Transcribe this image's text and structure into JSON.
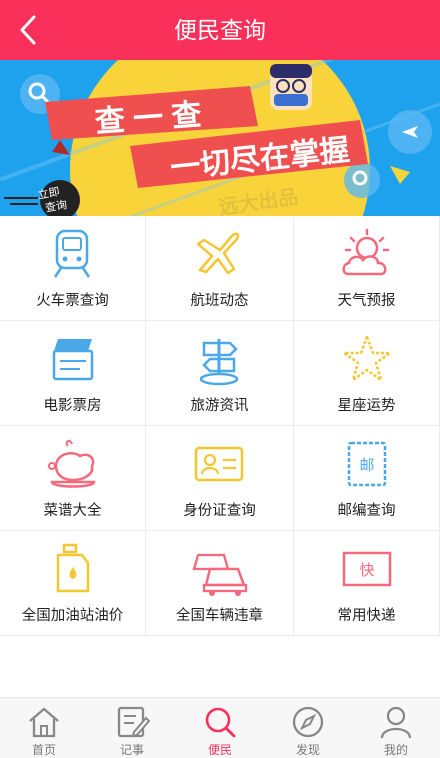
{
  "header": {
    "title": "便民查询"
  },
  "banner": {
    "headline_1": "查 一 查",
    "headline_2": "一切尽在掌握",
    "badge": [
      "立即",
      "查询"
    ],
    "watermark": "远大出品"
  },
  "services": [
    {
      "label": "火车票查询",
      "icon": "train-icon",
      "color": "#4aa8e8"
    },
    {
      "label": "航班动态",
      "icon": "airplane-icon",
      "color": "#f6c631"
    },
    {
      "label": "天气预报",
      "icon": "weather-icon",
      "color": "#f46a7c"
    },
    {
      "label": "电影票房",
      "icon": "clapperboard-icon",
      "color": "#4aa8e8"
    },
    {
      "label": "旅游资讯",
      "icon": "signpost-icon",
      "color": "#4aa8e8"
    },
    {
      "label": "星座运势",
      "icon": "star-icon",
      "color": "#f6c631"
    },
    {
      "label": "菜谱大全",
      "icon": "roast-chicken-icon",
      "color": "#f46a7c"
    },
    {
      "label": "身份证查询",
      "icon": "id-card-icon",
      "color": "#f6c631"
    },
    {
      "label": "邮编查询",
      "icon": "postage-stamp-icon",
      "color": "#4aa8e8",
      "stamp_text": "邮"
    },
    {
      "label": "全国加油站油价",
      "icon": "oil-bottle-icon",
      "color": "#f6c631"
    },
    {
      "label": "全国车辆违章",
      "icon": "cars-icon",
      "color": "#f46a7c"
    },
    {
      "label": "常用快递",
      "icon": "express-box-icon",
      "color": "#f46a7c",
      "box_text": "快"
    }
  ],
  "tabs": [
    {
      "label": "首页",
      "icon": "home-icon",
      "active": false
    },
    {
      "label": "记事",
      "icon": "notes-icon",
      "active": false
    },
    {
      "label": "便民",
      "icon": "search-icon",
      "active": true
    },
    {
      "label": "发现",
      "icon": "compass-icon",
      "active": false
    },
    {
      "label": "我的",
      "icon": "user-icon",
      "active": false
    }
  ],
  "colors": {
    "accent": "#f9305a",
    "banner_blue": "#1ea2ee",
    "banner_yellow": "#f8d43a"
  }
}
